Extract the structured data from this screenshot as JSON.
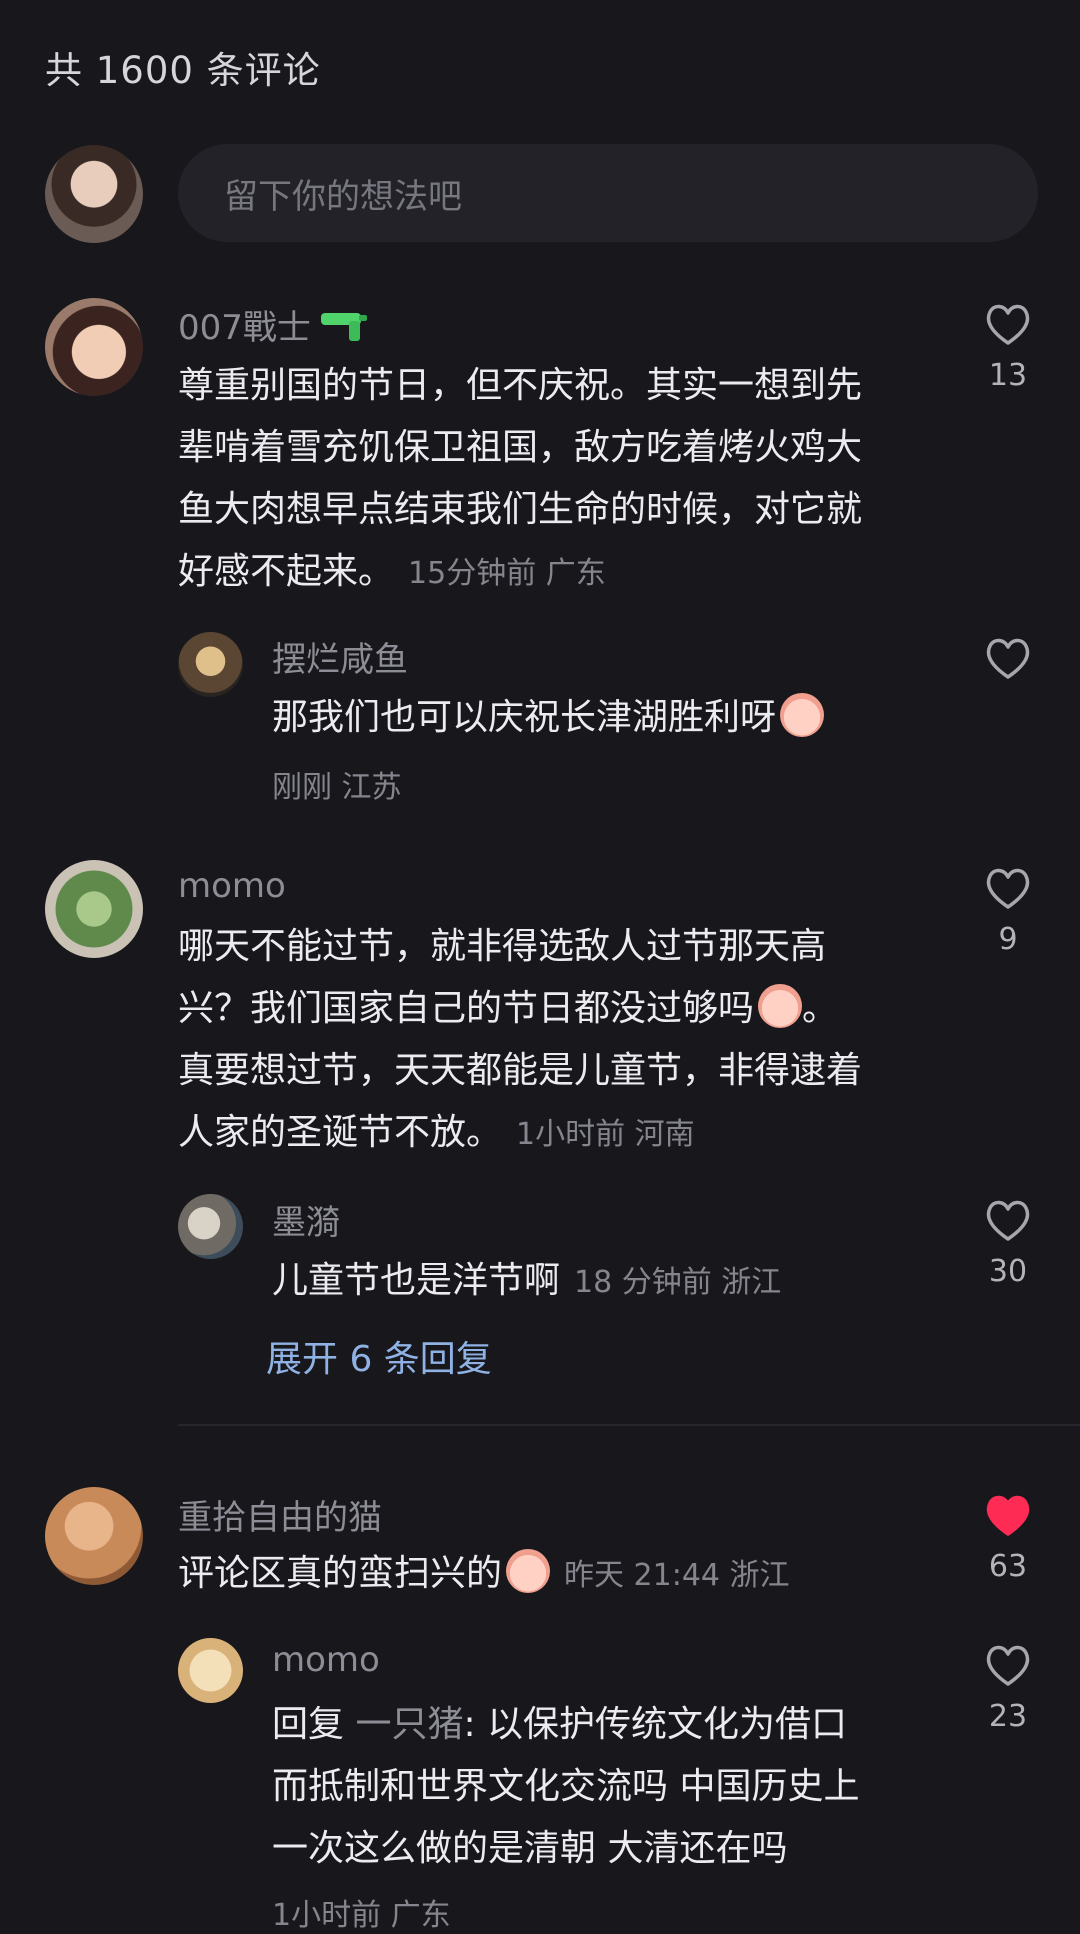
{
  "header": {
    "comment_count_label": "共 1600 条评论"
  },
  "composer": {
    "placeholder": "留下你的想法吧"
  },
  "comments": [
    {
      "username": "007戰士",
      "username_icon": "water-gun-icon",
      "text_lines": [
        "尊重别国的节日，但不庆祝。其实一想到先",
        "辈啃着雪充饥保卫祖国，敌方吃着烤火鸡大",
        "鱼大肉想早点结束我们生命的时候，对它就",
        "好感不起来。"
      ],
      "meta": "15分钟前 广东",
      "likes": "13",
      "liked": false
    },
    {
      "username": "摆烂咸鱼",
      "reply": true,
      "text": "那我们也可以庆祝长津湖胜利呀",
      "text_emoji": "peach-emoji",
      "meta": "刚刚 江苏",
      "likes": "",
      "liked": false
    },
    {
      "username": "momo",
      "text_lines": [
        "哪天不能过节，就非得选敌人过节那天高",
        "兴？我们国家自己的节日都没过够吗",
        "真要想过节，天天都能是儿童节，非得逮着",
        "人家的圣诞节不放。"
      ],
      "line2_suffix": "。",
      "text_emoji": "crying-peach-emoji",
      "meta": "1小时前 河南",
      "likes": "9",
      "liked": false
    },
    {
      "username": "墨漪",
      "reply": true,
      "text": "儿童节也是洋节啊",
      "meta": "18 分钟前 浙江",
      "likes": "30",
      "liked": false
    },
    {
      "username": "重拾自由的猫",
      "text": "评论区真的蛮扫兴的",
      "text_emoji": "crying-peach-emoji",
      "meta": "昨天 21:44 浙江",
      "likes": "63",
      "liked": true
    },
    {
      "username": "momo",
      "reply": true,
      "reply_prefix": "回复",
      "reply_to": "一只猪",
      "text_lines": [
        ": 以保护传统文化为借口",
        "而抵制和世界文化交流吗 中国历史上",
        "一次这么做的是清朝 大清还在吗"
      ],
      "meta": "1小时前 广东",
      "likes": "23",
      "liked": false
    }
  ],
  "expand_replies_label": "展开 6 条回复",
  "colors": {
    "background": "#17171c",
    "like_active": "#fe2c55",
    "link": "#8fb1e3"
  }
}
